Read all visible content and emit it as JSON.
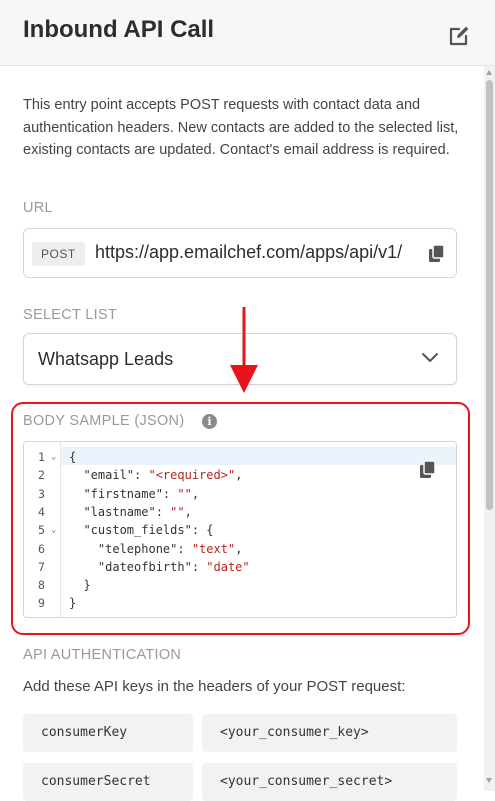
{
  "header": {
    "title": "Inbound API Call"
  },
  "description": "This entry point accepts POST requests with contact data and authentication headers. New contacts are added to the selected list, existing contacts are updated. Contact's email address is required.",
  "url_section": {
    "label": "URL",
    "method": "POST",
    "url": "https://app.emailchef.com/apps/api/v1/"
  },
  "select_list": {
    "label": "SELECT LIST",
    "value": "Whatsapp Leads"
  },
  "body_sample": {
    "label": "BODY SAMPLE (JSON)",
    "info": "i",
    "line_numbers": [
      "1",
      "2",
      "3",
      "4",
      "5",
      "6",
      "7",
      "8",
      "9"
    ],
    "lines": [
      {
        "pre": "{",
        "str": "",
        "post": ""
      },
      {
        "pre": "  \"email\": ",
        "str": "\"<required>\"",
        "post": ","
      },
      {
        "pre": "  \"firstname\": ",
        "str": "\"\"",
        "post": ","
      },
      {
        "pre": "  \"lastname\": ",
        "str": "\"\"",
        "post": ","
      },
      {
        "pre": "  \"custom_fields\": {",
        "str": "",
        "post": ""
      },
      {
        "pre": "    \"telephone\": ",
        "str": "\"text\"",
        "post": ","
      },
      {
        "pre": "    \"dateofbirth\": ",
        "str": "\"date\"",
        "post": ""
      },
      {
        "pre": "  }",
        "str": "",
        "post": ""
      },
      {
        "pre": "}",
        "str": "",
        "post": ""
      }
    ]
  },
  "api_auth": {
    "label": "API AUTHENTICATION",
    "description": "Add these API keys in the headers of your POST request:",
    "rows": [
      {
        "key": "consumerKey",
        "value": "<your_consumer_key>"
      },
      {
        "key": "consumerSecret",
        "value": "<your_consumer_secret>"
      }
    ]
  },
  "colors": {
    "highlight": "#e8141c",
    "string": "#b3261e",
    "active_line": "#eaf2fb"
  }
}
